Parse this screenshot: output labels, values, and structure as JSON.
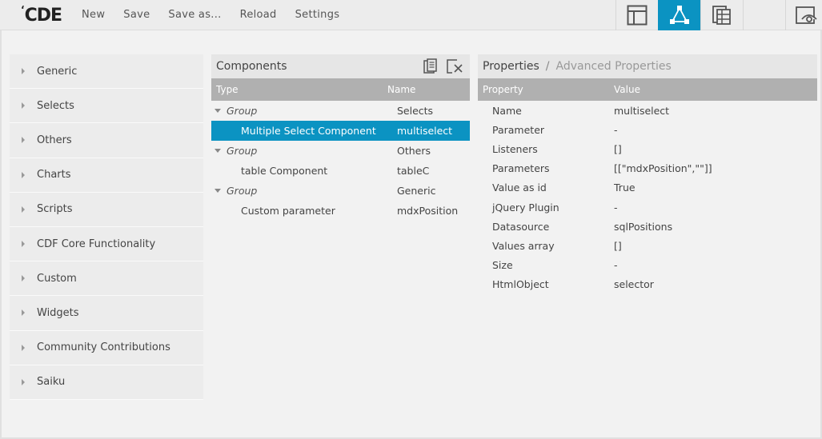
{
  "app": {
    "logo_tick": "‘",
    "logo_text": "CDE",
    "menu": [
      "New",
      "Save",
      "Save as...",
      "Reload",
      "Settings"
    ]
  },
  "view_buttons": [
    {
      "icon": "layout-icon",
      "active": false
    },
    {
      "icon": "components-icon",
      "active": true
    },
    {
      "icon": "datasources-icon",
      "active": false
    },
    {
      "icon": "preview-icon",
      "active": false
    }
  ],
  "palette": {
    "items": [
      "Generic",
      "Selects",
      "Others",
      "Charts",
      "Scripts",
      "CDF Core Functionality",
      "Custom",
      "Widgets",
      "Community Contributions",
      "Saiku"
    ]
  },
  "components": {
    "title": "Components",
    "columns": {
      "type": "Type",
      "name": "Name"
    },
    "rows": [
      {
        "kind": "group",
        "type": "Group",
        "name": "Selects"
      },
      {
        "kind": "item",
        "type": "Multiple Select Component",
        "name": "multiselect",
        "selected": true
      },
      {
        "kind": "group",
        "type": "Group",
        "name": "Others"
      },
      {
        "kind": "item",
        "type": "table Component",
        "name": "tableC"
      },
      {
        "kind": "group",
        "type": "Group",
        "name": "Generic"
      },
      {
        "kind": "item",
        "type": "Custom parameter",
        "name": "mdxPosition"
      }
    ]
  },
  "properties": {
    "title": "Properties",
    "separator": "/",
    "advanced": "Advanced Properties",
    "columns": {
      "property": "Property",
      "value": "Value"
    },
    "rows": [
      {
        "key": "Name",
        "value": "multiselect"
      },
      {
        "key": "Parameter",
        "value": "-"
      },
      {
        "key": "Listeners",
        "value": "[]"
      },
      {
        "key": "Parameters",
        "value": "[[\"mdxPosition\",\"\"]]"
      },
      {
        "key": "Value as id",
        "value": "True"
      },
      {
        "key": "jQuery Plugin",
        "value": "-"
      },
      {
        "key": "Datasource",
        "value": "sqlPositions"
      },
      {
        "key": "Values array",
        "value": "[]"
      },
      {
        "key": "Size",
        "value": "-"
      },
      {
        "key": "HtmlObject",
        "value": "selector"
      }
    ]
  },
  "colors": {
    "accent": "#0b93c2",
    "header_gray": "#b0b0b0",
    "panel_bg": "#ececec"
  }
}
